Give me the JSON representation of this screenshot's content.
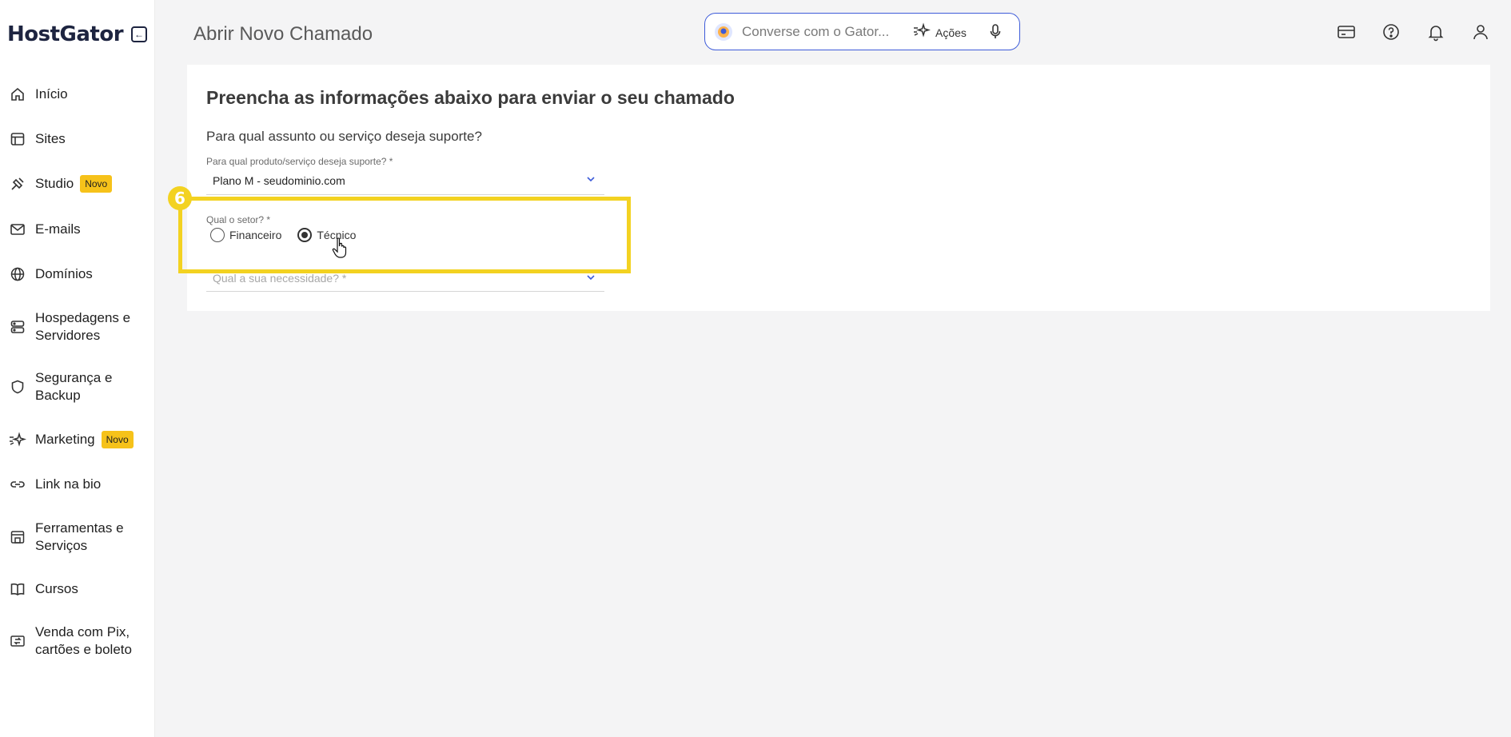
{
  "brand": {
    "name": "HostGator"
  },
  "sidebar": {
    "items": [
      {
        "label": "Início",
        "icon": "home-icon"
      },
      {
        "label": "Sites",
        "icon": "layout-icon"
      },
      {
        "label": "Studio",
        "icon": "studio-icon",
        "badge": "Novo"
      },
      {
        "label": "E-mails",
        "icon": "mail-icon"
      },
      {
        "label": "Domínios",
        "icon": "globe-icon"
      },
      {
        "label": "Hospedagens e Servidores",
        "icon": "server-icon"
      },
      {
        "label": "Segurança e Backup",
        "icon": "shield-icon"
      },
      {
        "label": "Marketing",
        "icon": "sparkles-icon",
        "badge": "Novo"
      },
      {
        "label": "Link na bio",
        "icon": "link-icon"
      },
      {
        "label": "Ferramentas e Serviços",
        "icon": "tools-icon"
      },
      {
        "label": "Cursos",
        "icon": "book-icon"
      },
      {
        "label": "Venda com Pix, cartões e boleto",
        "icon": "payment-icon"
      }
    ]
  },
  "header": {
    "title": "Abrir Novo Chamado",
    "search": {
      "placeholder": "Converse com o Gator...",
      "actions_label": "Ações"
    },
    "icons": [
      "card-icon",
      "help-icon",
      "bell-icon",
      "user-icon"
    ]
  },
  "form": {
    "heading": "Preencha as informações abaixo para enviar o seu chamado",
    "subheading": "Para qual assunto ou serviço deseja suporte?",
    "product_label": "Para qual produto/serviço deseja suporte? *",
    "product_value": "Plano M - seudominio.com",
    "sector_label": "Qual o setor? *",
    "sector_options": [
      {
        "label": "Financeiro",
        "selected": false
      },
      {
        "label": "Técnico",
        "selected": true
      }
    ],
    "need_placeholder": "Qual a sua necessidade? *"
  },
  "annotation": {
    "step": "6",
    "color": "#f3d221"
  },
  "colors": {
    "accent": "#3d5bd9",
    "badge": "#f6c21a",
    "brand": "#1d2440"
  }
}
